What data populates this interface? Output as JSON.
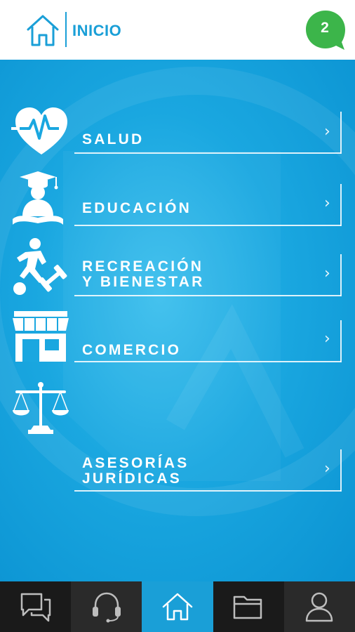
{
  "header": {
    "title": "INICIO",
    "notification_count": "2",
    "accent_color": "#1a9fd7",
    "badge_color": "#3cb54a"
  },
  "menu": [
    {
      "label": "SALUD",
      "icon": "heart-pulse-icon"
    },
    {
      "label": "EDUCACIÓN",
      "icon": "graduate-icon"
    },
    {
      "label": "RECREACIÓN\nY BIENESTAR",
      "icon": "sports-icon"
    },
    {
      "label": "COMERCIO",
      "icon": "store-icon"
    },
    {
      "label": "ASESORÍAS\nJURÍDICAS",
      "icon": "scales-icon"
    }
  ],
  "tabbar": {
    "active_tab": "home",
    "tabs": [
      {
        "name": "chat",
        "icon": "chat-icon"
      },
      {
        "name": "support",
        "icon": "headset-icon"
      },
      {
        "name": "home",
        "icon": "home-icon"
      },
      {
        "name": "folder",
        "icon": "folder-icon"
      },
      {
        "name": "profile",
        "icon": "user-icon"
      }
    ]
  }
}
